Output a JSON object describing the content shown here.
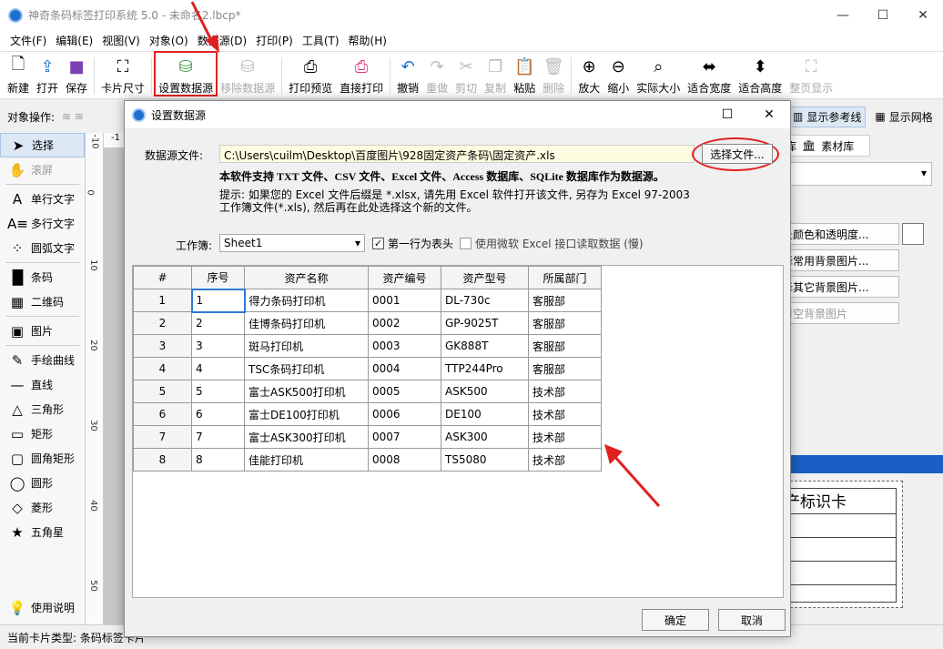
{
  "window": {
    "title": "神奇条码标签打印系统 5.0 - 未命名2.lbcp*",
    "minimize": "—",
    "maximize": "☐",
    "close": "✕"
  },
  "menu": [
    "文件(F)",
    "编辑(E)",
    "视图(V)",
    "对象(O)",
    "数据源(D)",
    "打印(P)",
    "工具(T)",
    "帮助(H)"
  ],
  "toolbar": {
    "new": "新建",
    "open": "打开",
    "save": "保存",
    "card_size": "卡片尺寸",
    "set_datasource": "设置数据源",
    "remove_datasource": "移除数据源",
    "print_preview": "打印预览",
    "direct_print": "直接打印",
    "undo": "撤销",
    "redo": "重做",
    "cut": "剪切",
    "copy": "复制",
    "paste": "粘贴",
    "delete": "删除",
    "zoom_in": "放大",
    "zoom_out": "缩小",
    "actual_size": "实际大小",
    "fit_width": "适合宽度",
    "fit_height": "适合高度",
    "full_page": "整页显示"
  },
  "object_ops": "对象操作:",
  "left_tools": [
    "选择",
    "滚屏",
    "单行文字",
    "多行文字",
    "圆弧文字",
    "条码",
    "二维码",
    "图片",
    "手绘曲线",
    "直线",
    "三角形",
    "矩形",
    "圆角矩形",
    "圆形",
    "菱形",
    "五角星",
    "使用说明"
  ],
  "ruler": {
    "h": "-1",
    "v": [
      "-10",
      "0",
      "10",
      "20",
      "30",
      "40",
      "50"
    ]
  },
  "right_panel": {
    "show_guides": "显示参考线",
    "show_grid": "显示网格",
    "tab1": "库",
    "tab_material": "素材库",
    "btn_bg_color": "景颜色和透明度...",
    "btn_common_bg": "择常用背景图片...",
    "btn_other_bg": "择其它背景图片...",
    "btn_clear_bg": "清空背景图片",
    "card_title": "产标识卡"
  },
  "status": {
    "card_type": "当前卡片类型: 条码标签卡片"
  },
  "dialog": {
    "title": "设置数据源",
    "file_label": "数据源文件:",
    "file_path": "C:\\Users\\cuilm\\Desktop\\百度图片\\928固定资产条码\\固定资产.xls",
    "choose_button": "选择文件...",
    "support_note": "本软件支持 TXT 文件、CSV 文件、Excel 文件、Access 数据库、SQLite 数据库作为数据源。",
    "hint": "提示: 如果您的 Excel 文件后缀是 *.xlsx, 请先用 Excel 软件打开该文件, 另存为 Excel 97-2003 工作簿文件(*.xls), 然后再在此处选择这个新的文件。",
    "workbook_label": "工作簿:",
    "sheet": "Sheet1",
    "first_row_header": "第一行为表头",
    "first_row_checked": "✓",
    "use_ms_excel": "使用微软 Excel 接口读取数据 (慢)",
    "ok": "确定",
    "cancel": "取消",
    "table": {
      "headers": [
        "#",
        "序号",
        "资产名称",
        "资产编号",
        "资产型号",
        "所属部门"
      ],
      "rows": [
        [
          "1",
          "1",
          "得力条码打印机",
          "0001",
          "DL-730c",
          "客服部"
        ],
        [
          "2",
          "2",
          "佳博条码打印机",
          "0002",
          "GP-9025T",
          "客服部"
        ],
        [
          "3",
          "3",
          "斑马打印机",
          "0003",
          "GK888T",
          "客服部"
        ],
        [
          "4",
          "4",
          "TSC条码打印机",
          "0004",
          "TTP244Pro",
          "客服部"
        ],
        [
          "5",
          "5",
          "富士ASK500打印机",
          "0005",
          "ASK500",
          "技术部"
        ],
        [
          "6",
          "6",
          "富士DE100打印机",
          "0006",
          "DE100",
          "技术部"
        ],
        [
          "7",
          "7",
          "富士ASK300打印机",
          "0007",
          "ASK300",
          "技术部"
        ],
        [
          "8",
          "8",
          "佳能打印机",
          "0008",
          "TS5080",
          "技术部"
        ]
      ]
    }
  },
  "colors": {
    "accent": "#1a5fc4",
    "annotation": "#e02020",
    "path_bg": "#fdfce0"
  }
}
